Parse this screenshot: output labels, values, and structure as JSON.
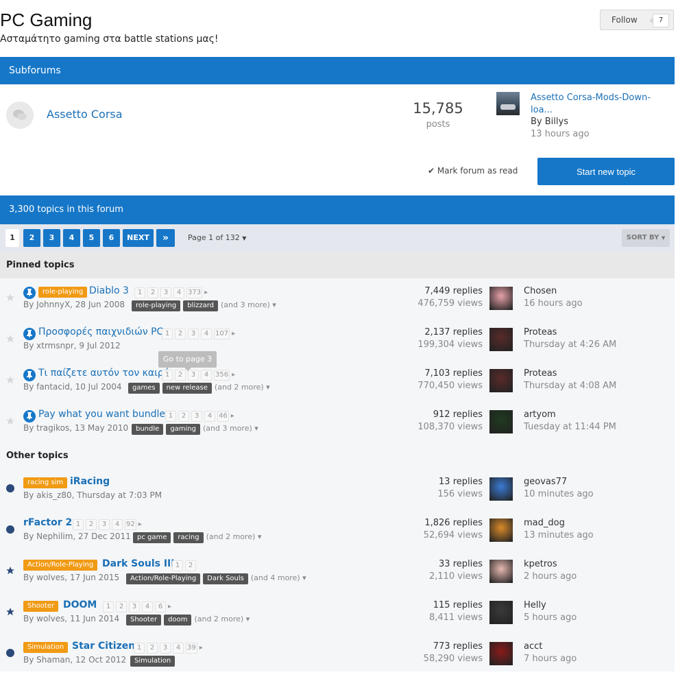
{
  "header": {
    "title": "PC Gaming",
    "subtitle": "Ασταμάτητο gaming στα battle stations μας!",
    "follow_label": "Follow",
    "follow_count": "7"
  },
  "subforums": {
    "heading": "Subforums",
    "item": {
      "name": "Assetto Corsa",
      "post_count": "15,785",
      "posts_label": "posts",
      "last_title": "Assetto Corsa-Mods-Down-loa...",
      "last_by": "By Billys",
      "last_time": "13 hours ago"
    }
  },
  "actions": {
    "mark_read": "Mark forum as read",
    "start_topic": "Start new topic"
  },
  "topics_bar": "3,300 topics in this forum",
  "pagination": {
    "pages": [
      "1",
      "2",
      "3",
      "4",
      "5",
      "6"
    ],
    "next": "NEXT",
    "last": "»",
    "page_of": "Page 1 of 132",
    "sort_by": "SORT BY"
  },
  "pinned_heading": "Pinned topics",
  "other_heading": "Other topics",
  "tooltip": "Go to page 3",
  "pinned": [
    {
      "prefix": "role-playing",
      "title": "Diablo 3",
      "pages": [
        "1",
        "2",
        "3",
        "4",
        "373"
      ],
      "meta": "By JohnnyX, 28 Jun 2008",
      "tags": [
        "role-playing",
        "blizzard"
      ],
      "more": "(and 3 more)",
      "replies": "7,449 replies",
      "views": "476,759 views",
      "lp_name": "Chosen",
      "lp_time": "16 hours ago"
    },
    {
      "prefix": "",
      "title": "Προσφορές παιχνιδιών PC",
      "pages": [
        "1",
        "2",
        "3",
        "4",
        "107"
      ],
      "meta": "By xtrmsnpr, 9 Jul 2012",
      "tags": [],
      "more": "",
      "replies": "2,137 replies",
      "views": "199,304 views",
      "lp_name": "Proteas",
      "lp_time": "Thursday at 4:26 AM"
    },
    {
      "prefix": "",
      "title": "Τι παίζετε αυτόν τον καιρό;",
      "pages": [
        "1",
        "2",
        "3",
        "4",
        "356"
      ],
      "meta": "By fantacid, 10 Jul 2004",
      "tags": [
        "games",
        "new release"
      ],
      "more": "(and 2 more)",
      "replies": "7,103 replies",
      "views": "770,450 views",
      "lp_name": "Proteas",
      "lp_time": "Thursday at 4:08 AM"
    },
    {
      "prefix": "",
      "title": "Pay what you want bundles",
      "pages": [
        "1",
        "2",
        "3",
        "4",
        "46"
      ],
      "meta": "By tragikos, 13 May 2010",
      "tags": [
        "bundle",
        "gaming"
      ],
      "more": "(and 3 more)",
      "replies": "912 replies",
      "views": "108,370 views",
      "lp_name": "artyom",
      "lp_time": "Tuesday at 11:44 PM"
    }
  ],
  "other": [
    {
      "prefix": "racing sim",
      "title": "iRacing",
      "pages": [],
      "meta": "By akis_z80, Thursday at 7:03 PM",
      "tags": [],
      "more": "",
      "replies": "13 replies",
      "views": "156 views",
      "lp_name": "geovas77",
      "lp_time": "10 minutes ago"
    },
    {
      "prefix": "",
      "title": "rFactor 2",
      "pages": [
        "1",
        "2",
        "3",
        "4",
        "92"
      ],
      "meta": "By Nephilim, 27 Dec 2011",
      "tags": [
        "pc game",
        "racing"
      ],
      "more": "(and 2 more)",
      "replies": "1,826 replies",
      "views": "52,694 views",
      "lp_name": "mad_dog",
      "lp_time": "13 minutes ago"
    },
    {
      "prefix": "Action/Role-Playing",
      "title": "Dark Souls III",
      "pages": [
        "1",
        "2"
      ],
      "meta": "By wolves, 17 Jun 2015",
      "tags": [
        "Action/Role-Playing",
        "Dark Souls"
      ],
      "more": "(and 4 more)",
      "replies": "33 replies",
      "views": "2,110 views",
      "lp_name": "kpetros",
      "lp_time": "2 hours ago"
    },
    {
      "prefix": "Shooter",
      "title": "DOOM",
      "pages": [
        "1",
        "2",
        "3",
        "4",
        "6"
      ],
      "meta": "By wolves, 11 Jun 2014",
      "tags": [
        "Shooter",
        "doom"
      ],
      "more": "(and 2 more)",
      "replies": "115 replies",
      "views": "8,411 views",
      "lp_name": "Helly",
      "lp_time": "5 hours ago"
    },
    {
      "prefix": "Simulation",
      "title": "Star Citizen",
      "pages": [
        "1",
        "2",
        "3",
        "4",
        "39"
      ],
      "meta": "By Shaman, 12 Oct 2012",
      "tags": [
        "Simulation"
      ],
      "more": "",
      "replies": "773 replies",
      "views": "58,290 views",
      "lp_name": "acct",
      "lp_time": "7 hours ago"
    }
  ]
}
